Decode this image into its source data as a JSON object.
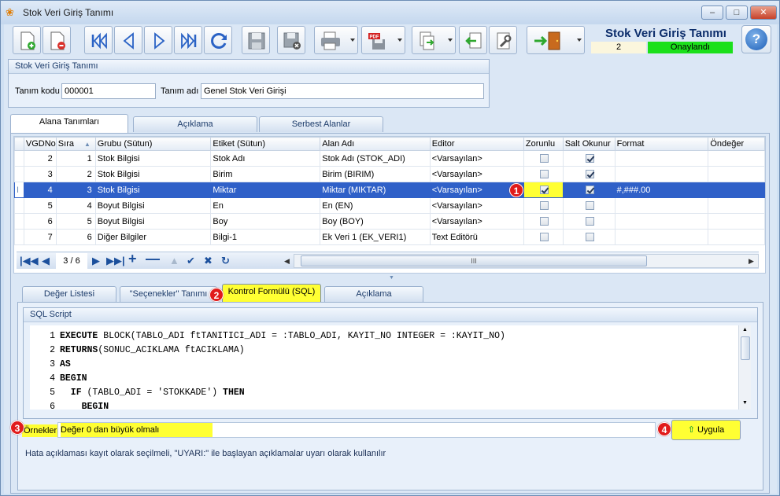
{
  "window": {
    "title": "Stok Veri Giriş Tanımı",
    "minimize": "–",
    "maximize": "□",
    "close": "✕"
  },
  "header": {
    "form_title": "Stok Veri Giriş Tanımı",
    "record_no": "2",
    "status": "Onaylandı",
    "status_color": "#1be01b"
  },
  "toolbar": {
    "icons": [
      "new-icon",
      "delete-icon",
      "first-icon",
      "prev-icon",
      "next-icon",
      "last-icon",
      "refresh-icon",
      "save-icon",
      "cancel-save-icon",
      "print-icon",
      "pdf-icon",
      "export-icon",
      "import-icon",
      "tools-icon",
      "exit-icon"
    ]
  },
  "definition": {
    "group_title": "Stok Veri Giriş Tanımı",
    "code_label": "Tanım kodu",
    "code_value": "000001",
    "name_label": "Tanım adı",
    "name_value": "Genel Stok Veri Girişi"
  },
  "top_tabs": [
    "Alana Tanımları",
    "Açıklama",
    "Serbest Alanlar"
  ],
  "grid": {
    "columns": [
      "VGDNo",
      "Sıra",
      "Grubu (Sütun)",
      "Etiket (Sütun)",
      "Alan Adı",
      "Editor",
      "Zorunlu",
      "Salt Okunur",
      "Format",
      "Öndeğer"
    ],
    "rows": [
      {
        "vgdno": "2",
        "sira": "1",
        "grubu": "Stok Bilgisi",
        "etiket": "Stok Adı",
        "alan": "Stok Adı (STOK_ADI)",
        "editor": "<Varsayılan>",
        "zorunlu": false,
        "salt": true,
        "format": "",
        "ondeger": ""
      },
      {
        "vgdno": "3",
        "sira": "2",
        "grubu": "Stok Bilgisi",
        "etiket": "Birim",
        "alan": "Birim (BIRIM)",
        "editor": "<Varsayılan>",
        "zorunlu": false,
        "salt": true,
        "format": "",
        "ondeger": ""
      },
      {
        "vgdno": "4",
        "sira": "3",
        "grubu": "Stok Bilgisi",
        "etiket": "Miktar",
        "alan": "Miktar (MIKTAR)",
        "editor": "<Varsayılan>",
        "zorunlu": true,
        "salt": true,
        "format": "#,###.00",
        "ondeger": ""
      },
      {
        "vgdno": "5",
        "sira": "4",
        "grubu": "Boyut Bilgisi",
        "etiket": "En",
        "alan": "En (EN)",
        "editor": "<Varsayılan>",
        "zorunlu": false,
        "salt": false,
        "format": "",
        "ondeger": ""
      },
      {
        "vgdno": "6",
        "sira": "5",
        "grubu": "Boyut Bilgisi",
        "etiket": "Boy",
        "alan": "Boy (BOY)",
        "editor": "<Varsayılan>",
        "zorunlu": false,
        "salt": false,
        "format": "",
        "ondeger": ""
      },
      {
        "vgdno": "7",
        "sira": "6",
        "grubu": "Diğer Bilgiler",
        "etiket": "Bilgi-1",
        "alan": "Ek Veri 1 (EK_VERI1)",
        "editor": "Text Editörü",
        "zorunlu": false,
        "salt": false,
        "format": "",
        "ondeger": ""
      }
    ]
  },
  "navigator": {
    "position": "3 / 6",
    "scroll_grip": "III"
  },
  "bottom_tabs": [
    "Değer Listesi",
    "\"Seçenekler\" Tanımı",
    "Kontrol Formülü (SQL)",
    "Açıklama"
  ],
  "sql": {
    "group_title": "SQL Script",
    "lines": [
      {
        "n": "1",
        "kw": "EXECUTE",
        "rest": " BLOCK(TABLO_ADI ftTANITICI_ADI = :TABLO_ADI, KAYIT_NO INTEGER = :KAYIT_NO)"
      },
      {
        "n": "2",
        "kw": "RETURNS",
        "rest": "(SONUC_ACIKLAMA ftACIKLAMA)"
      },
      {
        "n": "3",
        "kw": "AS",
        "rest": ""
      },
      {
        "n": "4",
        "kw": "BEGIN",
        "rest": ""
      },
      {
        "n": "5",
        "kw": "  IF",
        "rest": " (TABLO_ADI = 'STOKKADE') ",
        "kw2": "THEN"
      },
      {
        "n": "6",
        "kw": "    BEGIN",
        "rest": ""
      }
    ]
  },
  "examples": {
    "label": "Örnekler",
    "value": "Değer 0 dan büyük olmalı",
    "apply_button": "Uygula"
  },
  "hint": "Hata açıklaması kayıt olarak seçilmeli, \"UYARI:\" ile başlayan açıklamalar uyarı olarak kullanılır",
  "badges": [
    "1",
    "2",
    "3",
    "4"
  ],
  "colors": {
    "highlight": "#ffff33",
    "selected_row": "#2f60c8",
    "badge": "#e11b1b"
  }
}
